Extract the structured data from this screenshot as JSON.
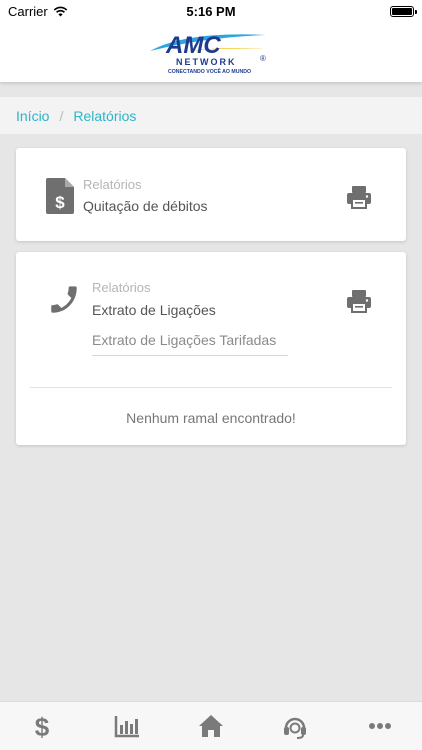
{
  "status_bar": {
    "carrier": "Carrier",
    "time": "5:16 PM",
    "icons": [
      "wifi-icon",
      "battery-icon"
    ]
  },
  "header": {
    "logo": {
      "brand": "AMC",
      "word": "NETWORK",
      "tagline": "CONECTANDO VOCÊ AO MUNDO",
      "mark": "®"
    }
  },
  "breadcrumb": {
    "items": [
      "Início",
      "Relatórios"
    ],
    "separator": "/"
  },
  "cards": [
    {
      "subtitle": "Relatórios",
      "title": "Quitação de débitos",
      "icon": "dollar-document-icon",
      "action_icon": "print-icon"
    },
    {
      "subtitle": "Relatórios",
      "title": "Extrato de Ligações",
      "icon": "phone-icon",
      "action_icon": "print-icon",
      "select_value": "Extrato de Ligações Tarifadas",
      "empty_message": "Nenhum ramal encontrado!"
    }
  ],
  "tab_bar": {
    "tabs": [
      "dollar-icon",
      "bar-chart-icon",
      "home-icon",
      "headset-icon",
      "more-icon"
    ]
  },
  "colors": {
    "accent": "#2bb5c9",
    "icon_gray": "#7a7a7a",
    "background": "#e6e6e6",
    "logo_blue": "#1d3a8f",
    "logo_yellow": "#f3c21b",
    "logo_cyan": "#2aa6de"
  }
}
